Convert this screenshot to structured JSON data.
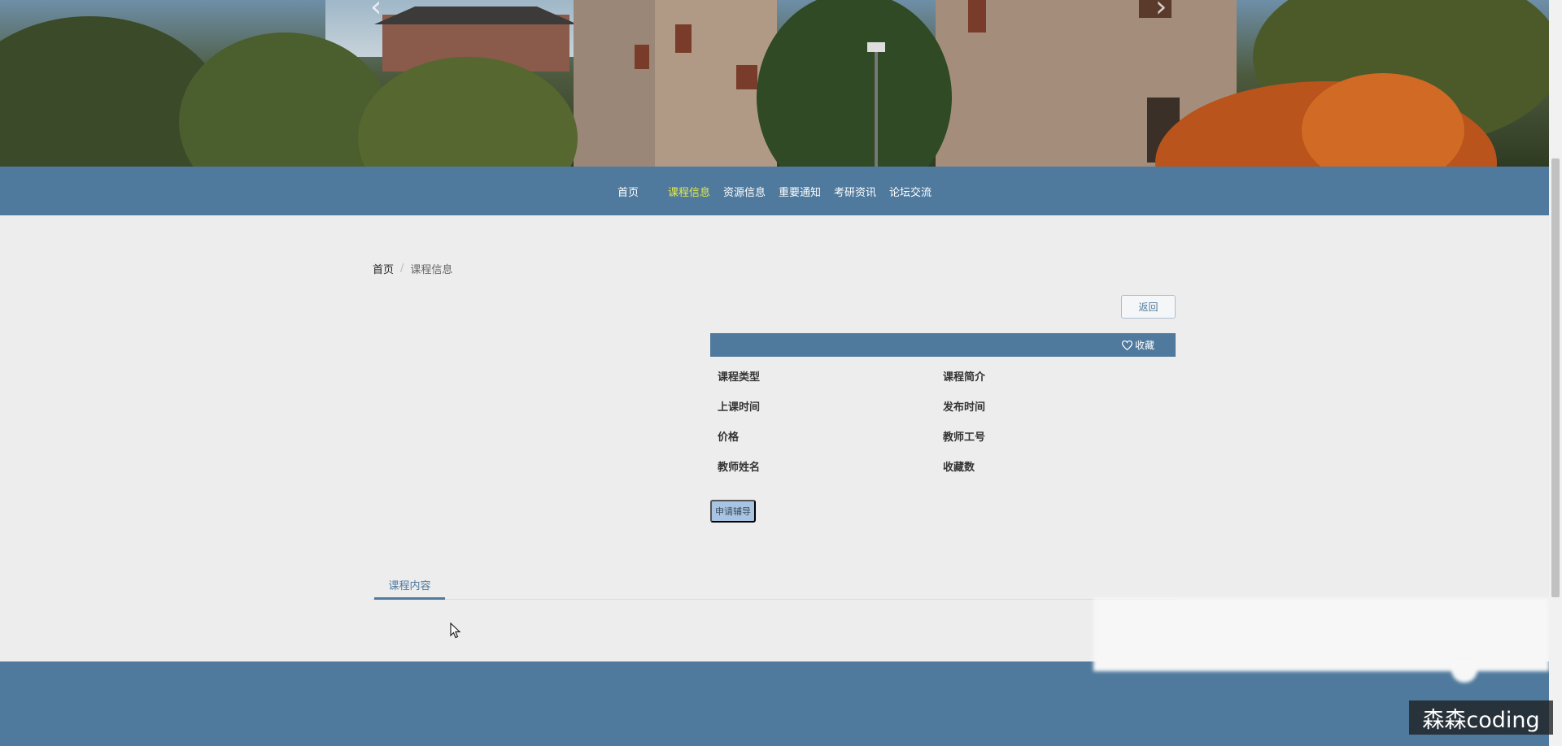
{
  "nav": {
    "items": [
      "首页",
      "课程信息",
      "资源信息",
      "重要通知",
      "考研资讯",
      "论坛交流"
    ],
    "active_index": 1
  },
  "breadcrumb": {
    "home": "首页",
    "separator": "/",
    "current": "课程信息"
  },
  "actions": {
    "back_label": "返回",
    "favorite_label": "收藏",
    "apply_label": "申请辅导"
  },
  "fields": {
    "course_type": "课程类型",
    "course_intro": "课程简介",
    "class_time": "上课时间",
    "publish_time": "发布时间",
    "price": "价格",
    "teacher_id": "教师工号",
    "teacher_name": "教师姓名",
    "favorite_count": "收藏数"
  },
  "tabs": {
    "content_label": "课程内容"
  },
  "watermark": "森森coding",
  "colors": {
    "primary": "#4f7a9e",
    "active_nav": "#e4e94a",
    "page_bg": "#ededed",
    "apply_button": "#a7c5e3"
  }
}
